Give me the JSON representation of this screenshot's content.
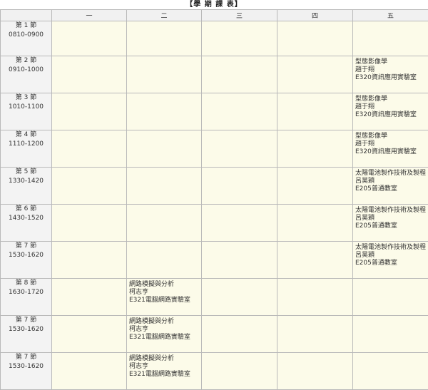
{
  "title": "【學 期 課 表】",
  "days": [
    "一",
    "二",
    "三",
    "四",
    "五"
  ],
  "rows": [
    {
      "label": "第 1 節",
      "time": "0810-0900",
      "cells": [
        null,
        null,
        null,
        null,
        null
      ]
    },
    {
      "label": "第 2 節",
      "time": "0910-1000",
      "cells": [
        null,
        null,
        null,
        null,
        {
          "course": "型態影像學",
          "teacher": "趙于翔",
          "room": "E320資訊應用實驗室"
        }
      ]
    },
    {
      "label": "第 3 節",
      "time": "1010-1100",
      "cells": [
        null,
        null,
        null,
        null,
        {
          "course": "型態影像學",
          "teacher": "趙于翔",
          "room": "E320資訊應用實驗室"
        }
      ]
    },
    {
      "label": "第 4 節",
      "time": "1110-1200",
      "cells": [
        null,
        null,
        null,
        null,
        {
          "course": "型態影像學",
          "teacher": "趙于翔",
          "room": "E320資訊應用實驗室"
        }
      ]
    },
    {
      "label": "第 5 節",
      "time": "1330-1420",
      "cells": [
        null,
        null,
        null,
        null,
        {
          "course": "太陽電池製作技術及製程",
          "teacher": "呂昊穎",
          "room": "E205普通教室"
        }
      ]
    },
    {
      "label": "第 6 節",
      "time": "1430-1520",
      "cells": [
        null,
        null,
        null,
        null,
        {
          "course": "太陽電池製作技術及製程",
          "teacher": "呂昊穎",
          "room": "E205普通教室"
        }
      ]
    },
    {
      "label": "第 7 節",
      "time": "1530-1620",
      "cells": [
        null,
        null,
        null,
        null,
        {
          "course": "太陽電池製作技術及製程",
          "teacher": "呂昊穎",
          "room": "E205普通教室"
        }
      ]
    },
    {
      "label": "第 8 節",
      "time": "1630-1720",
      "cells": [
        null,
        {
          "course": "網路模擬與分析",
          "teacher": "柯志亨",
          "room": "E321電腦網路實驗室"
        },
        null,
        null,
        null
      ]
    },
    {
      "label": "第 7 節",
      "time": "1530-1620",
      "cells": [
        null,
        {
          "course": "網路模擬與分析",
          "teacher": "柯志亨",
          "room": "E321電腦網路實驗室"
        },
        null,
        null,
        null
      ]
    },
    {
      "label": "第 7 節",
      "time": "1530-1620",
      "cells": [
        null,
        {
          "course": "網路模擬與分析",
          "teacher": "柯志亨",
          "room": "E321電腦網路實驗室"
        },
        null,
        null,
        null
      ]
    }
  ]
}
